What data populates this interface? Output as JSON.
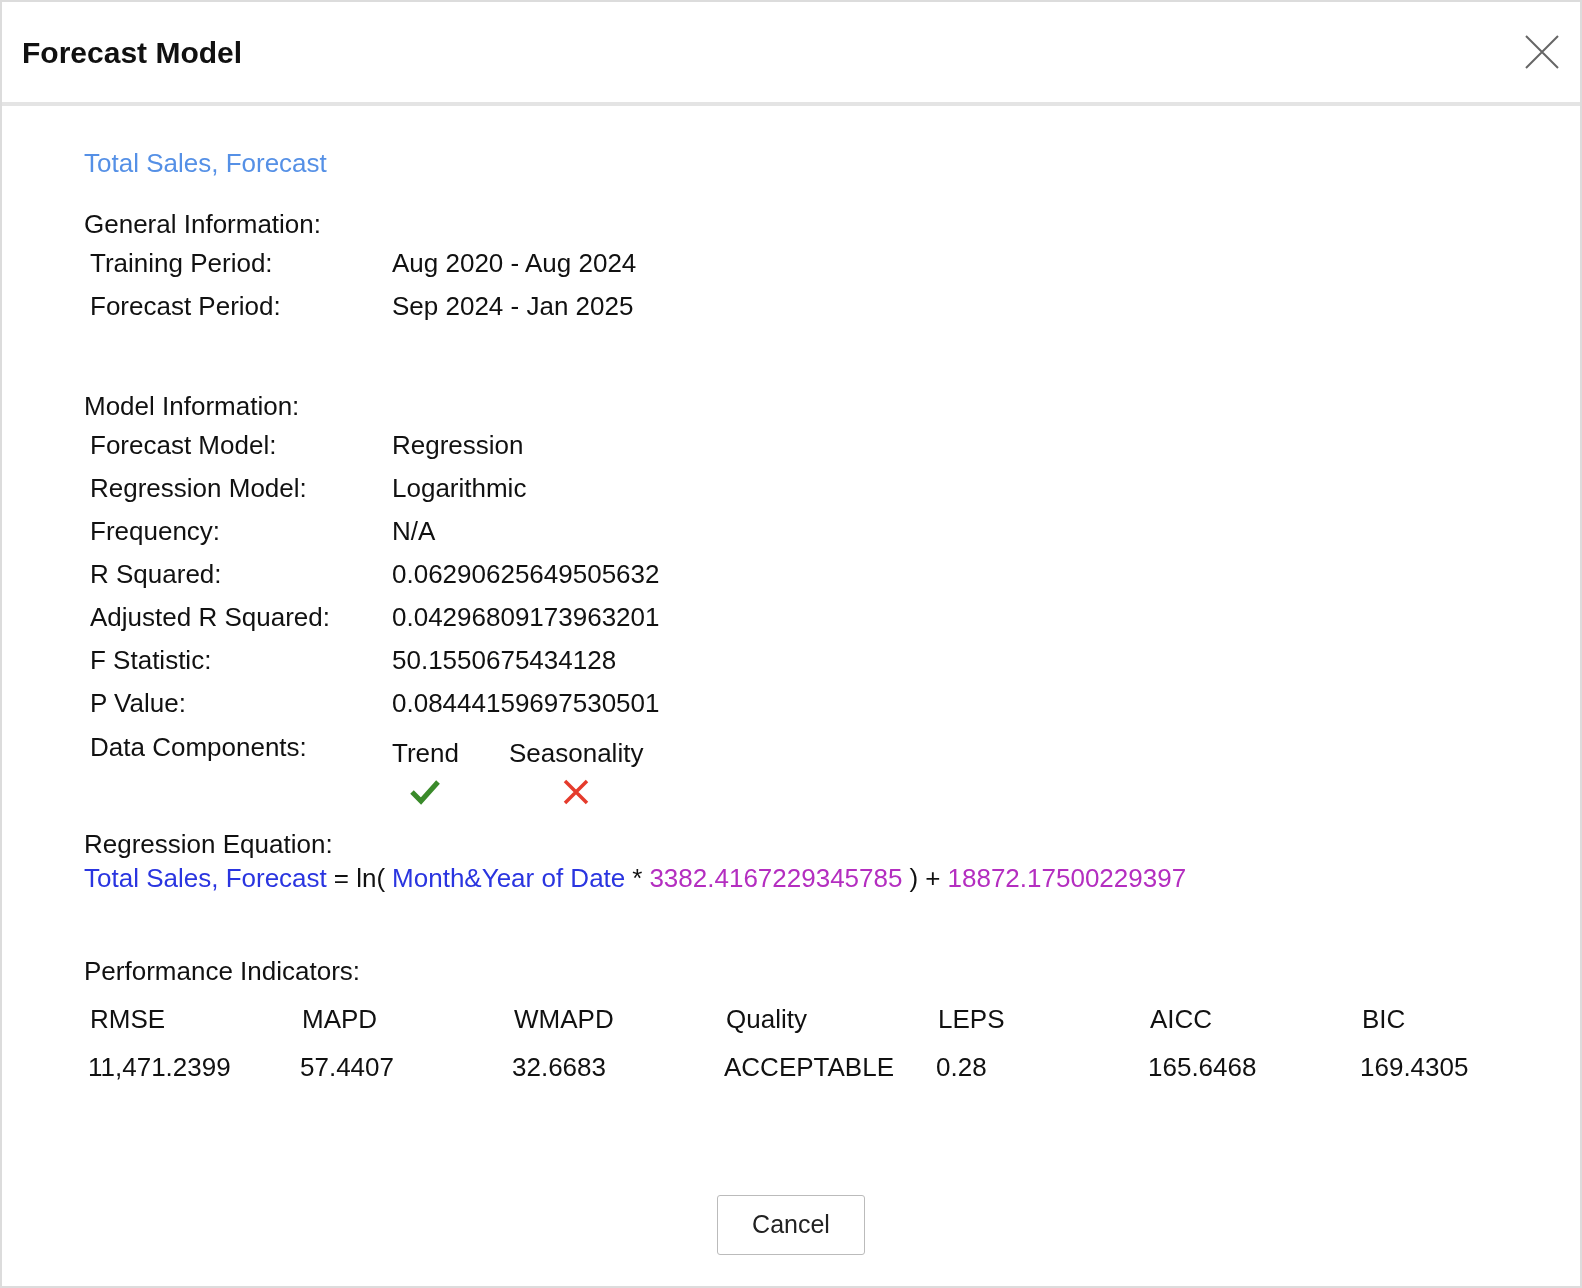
{
  "dialog": {
    "title": "Forecast Model"
  },
  "measure": "Total Sales, Forecast",
  "general": {
    "heading": "General Information:",
    "rows": [
      {
        "label": "Training Period:",
        "value": "Aug 2020 - Aug 2024"
      },
      {
        "label": "Forecast Period:",
        "value": "Sep 2024 - Jan 2025"
      }
    ]
  },
  "model": {
    "heading": "Model Information:",
    "rows": [
      {
        "label": "Forecast Model:",
        "value": "Regression"
      },
      {
        "label": "Regression Model:",
        "value": "Logarithmic"
      },
      {
        "label": "Frequency:",
        "value": "N/A"
      },
      {
        "label": "R Squared:",
        "value": "0.06290625649505632"
      },
      {
        "label": "Adjusted R Squared:",
        "value": "0.04296809173963201"
      },
      {
        "label": "F Statistic:",
        "value": "50.1550675434128"
      },
      {
        "label": "P Value:",
        "value": "0.08444159697530501"
      }
    ],
    "components_label": "Data Components:",
    "components": [
      {
        "label": "Trend",
        "present": true
      },
      {
        "label": "Seasonality",
        "present": false
      }
    ]
  },
  "equation": {
    "heading": "Regression Equation:",
    "parts": [
      {
        "kind": "field",
        "text": "Total Sales, Forecast"
      },
      {
        "kind": "operator",
        "text": "= ln("
      },
      {
        "kind": "field",
        "text": "Month&Year of Date"
      },
      {
        "kind": "operator",
        "text": "*"
      },
      {
        "kind": "number",
        "text": "3382.4167229345785"
      },
      {
        "kind": "operator",
        "text": ") +"
      },
      {
        "kind": "number",
        "text": "18872.17500229397"
      }
    ]
  },
  "performance": {
    "heading": "Performance Indicators:",
    "columns": [
      {
        "name": "RMSE",
        "value": "11,471.2399"
      },
      {
        "name": "MAPD",
        "value": "57.4407"
      },
      {
        "name": "WMAPD",
        "value": "32.6683"
      },
      {
        "name": "Quality",
        "value": "ACCEPTABLE"
      },
      {
        "name": "LEPS",
        "value": "0.28"
      },
      {
        "name": "AICC",
        "value": "165.6468"
      },
      {
        "name": "BIC",
        "value": "169.4305"
      }
    ]
  },
  "buttons": [
    "Cancel"
  ]
}
